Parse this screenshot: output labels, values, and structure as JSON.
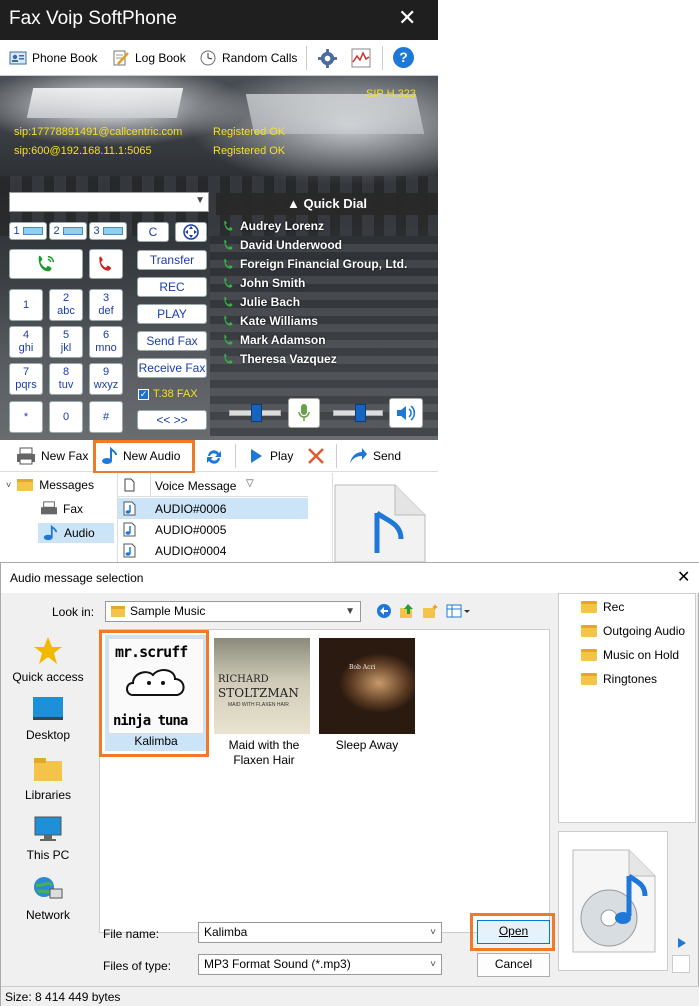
{
  "phone": {
    "title": "Fax Voip SoftPhone",
    "close": "✕",
    "toolbar": {
      "phonebook": "Phone Book",
      "logbook": "Log Book",
      "random": "Random Calls",
      "help": "?"
    },
    "protocol": "SIP  H.323",
    "accounts": [
      {
        "uri": "sip:17778891491@callcentric.com",
        "status": "Registered OK"
      },
      {
        "uri": "sip:600@192.168.11.1:5065",
        "status": "Registered OK"
      }
    ],
    "lines": [
      "1",
      "2",
      "3"
    ],
    "keys": [
      {
        "d": "1",
        "l": ""
      },
      {
        "d": "2",
        "l": "abc"
      },
      {
        "d": "3",
        "l": "def"
      },
      {
        "d": "4",
        "l": "ghi"
      },
      {
        "d": "5",
        "l": "jkl"
      },
      {
        "d": "6",
        "l": "mno"
      },
      {
        "d": "7",
        "l": "pqrs"
      },
      {
        "d": "8",
        "l": "tuv"
      },
      {
        "d": "9",
        "l": "wxyz"
      },
      {
        "d": "*",
        "l": ""
      },
      {
        "d": "0",
        "l": ""
      },
      {
        "d": "#",
        "l": ""
      }
    ],
    "func": {
      "clear": "C",
      "transfer": "Transfer",
      "rec": "REC",
      "play": "PLAY",
      "sendfax": "Send Fax",
      "receivefax": "Receive Fax",
      "t38": "T.38 FAX",
      "more": "<< >>"
    },
    "quick_dial_title": "Quick Dial",
    "quick_dial": [
      "Audrey Lorenz",
      "David Underwood",
      "Foreign Financial Group, Ltd.",
      "John Smith",
      "Julie Bach",
      "Kate Williams",
      "Mark Adamson",
      "Theresa Vazquez"
    ],
    "bottom": {
      "newfax": "New Fax",
      "newaudio": "New Audio",
      "play": "Play",
      "send": "Send"
    },
    "tree": {
      "messages": "Messages",
      "fax": "Fax",
      "audio": "Audio"
    },
    "vlist": {
      "header": "Voice Message",
      "sort": "▽",
      "items": [
        "AUDIO#0006",
        "AUDIO#0005",
        "AUDIO#0004"
      ]
    }
  },
  "dialog": {
    "title": "Audio message selection",
    "close": "✕",
    "lookin_label": "Look in:",
    "lookin_value": "Sample Music",
    "places": [
      "Quick access",
      "Desktop",
      "Libraries",
      "This PC",
      "Network"
    ],
    "files": [
      {
        "name": "Kalimba",
        "art1": "mr.scruff",
        "art2": "ninja tuna"
      },
      {
        "name": "Maid with the Flaxen Hair",
        "art1": "RICHARD",
        "art2": "STOLTZMAN",
        "art3": "MAID WITH FLAXEN HAIR"
      },
      {
        "name": "Sleep Away",
        "art1": "Bob Acri"
      }
    ],
    "folders": [
      "Rec",
      "Outgoing Audio",
      "Music on Hold",
      "Ringtones"
    ],
    "filename_label": "File name:",
    "filename_value": "Kalimba",
    "filetype_label": "Files of type:",
    "filetype_value": "MP3 Format Sound (*.mp3)",
    "open": "Open",
    "cancel": "Cancel",
    "status": "Size: 8 414 449 bytes"
  }
}
